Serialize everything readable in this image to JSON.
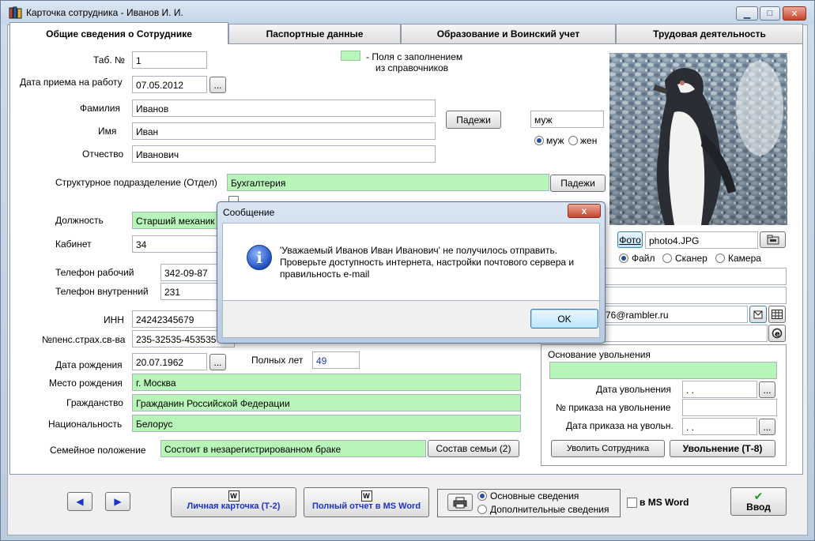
{
  "window": {
    "title": "Карточка сотрудника -  Иванов И. И."
  },
  "tabs": [
    {
      "label": "Общие сведения о Сотруднике",
      "active": true
    },
    {
      "label": "Паспортные данные"
    },
    {
      "label": "Образование и Воинский учет"
    },
    {
      "label": "Трудовая деятельность"
    }
  ],
  "legend": {
    "line1": "-  Поля с заполнением",
    "line2": "из справочников",
    "color": "#b8f5b8"
  },
  "form": {
    "tab_no_label": "Таб. №",
    "tab_no": "1",
    "hire_date_label": "Дата приема на работу",
    "hire_date": "07.05.2012",
    "surname_label": "Фамилия",
    "surname": "Иванов",
    "name_label": "Имя",
    "name": "Иван",
    "patronymic_label": "Отчество",
    "patronymic": "Иванович",
    "cases_button": "Падежи",
    "gender_value": "муж",
    "gender_male": "муж",
    "gender_female": "жен",
    "department_label": "Структурное подразделение (Отдел)",
    "department": "Бухгалтерия",
    "dept_cases_button": "Падежи",
    "position_label": "Должность",
    "position": "Старший механик",
    "office_label": "Кабинет",
    "office": "34",
    "phone_work_label": "Телефон рабочий",
    "phone_work": "342-09-87",
    "phone_internal_label": "Телефон внутренний",
    "phone_internal": "231",
    "inn_label": "ИНН",
    "inn": "24242345679",
    "pension_label": "№пенс.страх.св-ва",
    "pension": "235-32535-453535",
    "birth_label": "Дата рождения",
    "birth": "20.07.1962",
    "full_years_label": "Полных лет",
    "full_years": "49",
    "birthplace_label": "Место рождения",
    "birthplace": "г. Москва",
    "citizenship_label": "Гражданство",
    "citizenship": "Гражданин Российской Федерации",
    "nationality_label": "Национальность",
    "nationality": "Белорус",
    "marital_label": "Семейное положение",
    "marital": "Состоит в незарегистрированном браке",
    "family_button": "Состав семьи (2)"
  },
  "photo_panel": {
    "photo_button": "Фото",
    "photo_file": "photo4.JPG",
    "source_file": "Файл",
    "source_scanner": "Сканер",
    "source_camera": "Камера",
    "email": "76@rambler.ru"
  },
  "dismissal": {
    "title": "Основание увольнения",
    "date_label": "Дата увольнения",
    "date": " .  .",
    "order_no_label": "№ приказа на увольнение",
    "order_no": "",
    "order_date_label": "Дата приказа на увольн.",
    "order_date": " .  .",
    "dismiss_button": "Уволить Сотрудника",
    "t8_button": "Увольнение (Т-8)"
  },
  "footer": {
    "card_button": "Личная карточка (Т-2)",
    "report_button": "Полный отчет в MS Word",
    "print_main": "Основные сведения",
    "print_extra": "Дополнительные сведения",
    "msword_check": "в MS Word",
    "enter_button": "Ввод"
  },
  "dialog": {
    "title": "Сообщение",
    "close": "x",
    "message": "'Уважаемый Иванов Иван Иванович' не получилось отправить. Проверьте доступность интернета, настройки почтового сервера и правильность e-mail",
    "ok": "OK"
  },
  "icons": {
    "info": "info-icon",
    "arrow_left": "◀",
    "arrow_right": "▶",
    "ellipsis": "...",
    "check": "✔"
  }
}
